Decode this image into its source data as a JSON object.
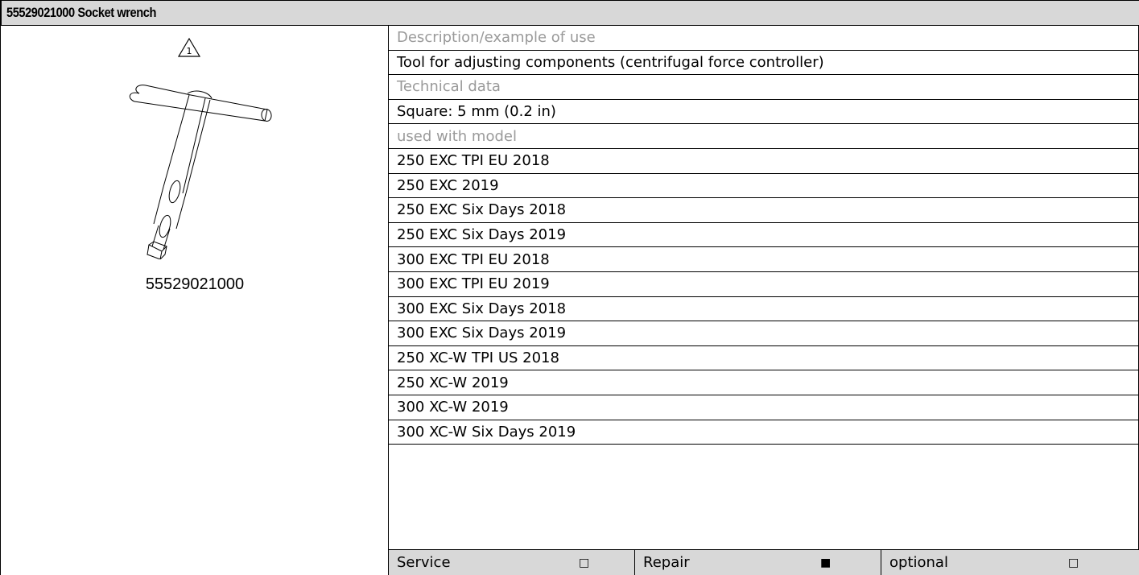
{
  "header": {
    "title": "55529021000 Socket wrench"
  },
  "figure": {
    "part_number": "55529021000",
    "warning_icon": "warning-triangle-1-icon",
    "tool_image": "socket-wrench-drawing"
  },
  "details": {
    "description_label": "Description/example of use",
    "description": "Tool for adjusting components (centrifugal force controller)",
    "technical_label": "Technical data",
    "technical": "Square: 5 mm (0.2 in)",
    "models_label": "used with model",
    "models": [
      "250 EXC TPI EU 2018",
      "250 EXC 2019",
      "250 EXC Six Days 2018",
      "250 EXC Six Days 2019",
      "300 EXC TPI EU 2018",
      "300 EXC TPI EU 2019",
      "300 EXC Six Days 2018",
      "300 EXC Six Days 2019",
      "250 XC-W TPI US 2018",
      "250 XC-W 2019",
      "300 XC-W 2019",
      "300 XC-W Six Days 2019"
    ]
  },
  "footer": {
    "service_label": "Service",
    "service_mark": "□",
    "repair_label": "Repair",
    "repair_mark": "■",
    "optional_label": "optional",
    "optional_mark": "□"
  }
}
